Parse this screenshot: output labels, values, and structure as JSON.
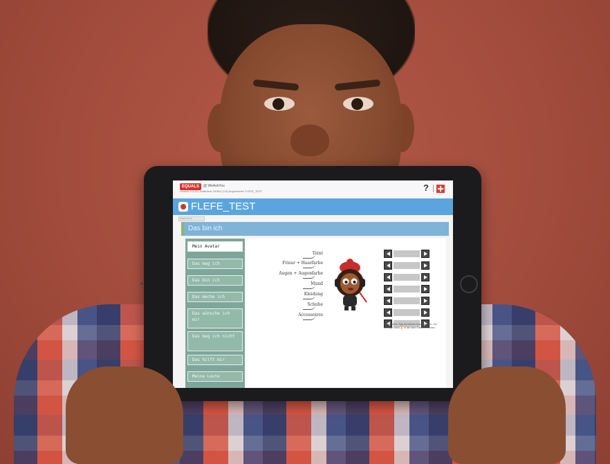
{
  "app": {
    "logo": "EQUALS",
    "logo_sub": "@ WeAskYou",
    "version_line": "Version 3.3.28 | Institution: DEMO (CH) Angemeldet: FLEFE_TEST",
    "help_label": "?",
    "user_title": "FLEFE_TEST",
    "breadcrumb": "Avatar bis 12..."
  },
  "section": {
    "title": "Das bin ich"
  },
  "nav": {
    "items": [
      {
        "label": "Mein Avatar",
        "active": true
      },
      {
        "label": "Das mag ich"
      },
      {
        "label": "Das bin ich"
      },
      {
        "label": "Das mache ich"
      },
      {
        "label": "Das wünsche ich mir"
      },
      {
        "label": "Das mag ich nicht"
      },
      {
        "label": "Das hilft mir"
      },
      {
        "label": "Meine Leute"
      }
    ]
  },
  "avatar_editor": {
    "labels": [
      "Teint",
      "Frisur + Haarfarbe",
      "Augen + Augenfarbe",
      "Mund",
      "Kleidung",
      "Schuhe",
      "Accessoires"
    ],
    "note": "Accessoires: Tipp auf deinen Avatar spielen. Zur Anzeige Hand ☝ in die oben Farbtöne ziehen."
  },
  "colors": {
    "backdrop": "#a24c3d",
    "header_blue": "#5aa5de",
    "section_blue": "#7fb3d8",
    "nav_green": "#7fa69a",
    "brand_red": "#d9322b"
  }
}
